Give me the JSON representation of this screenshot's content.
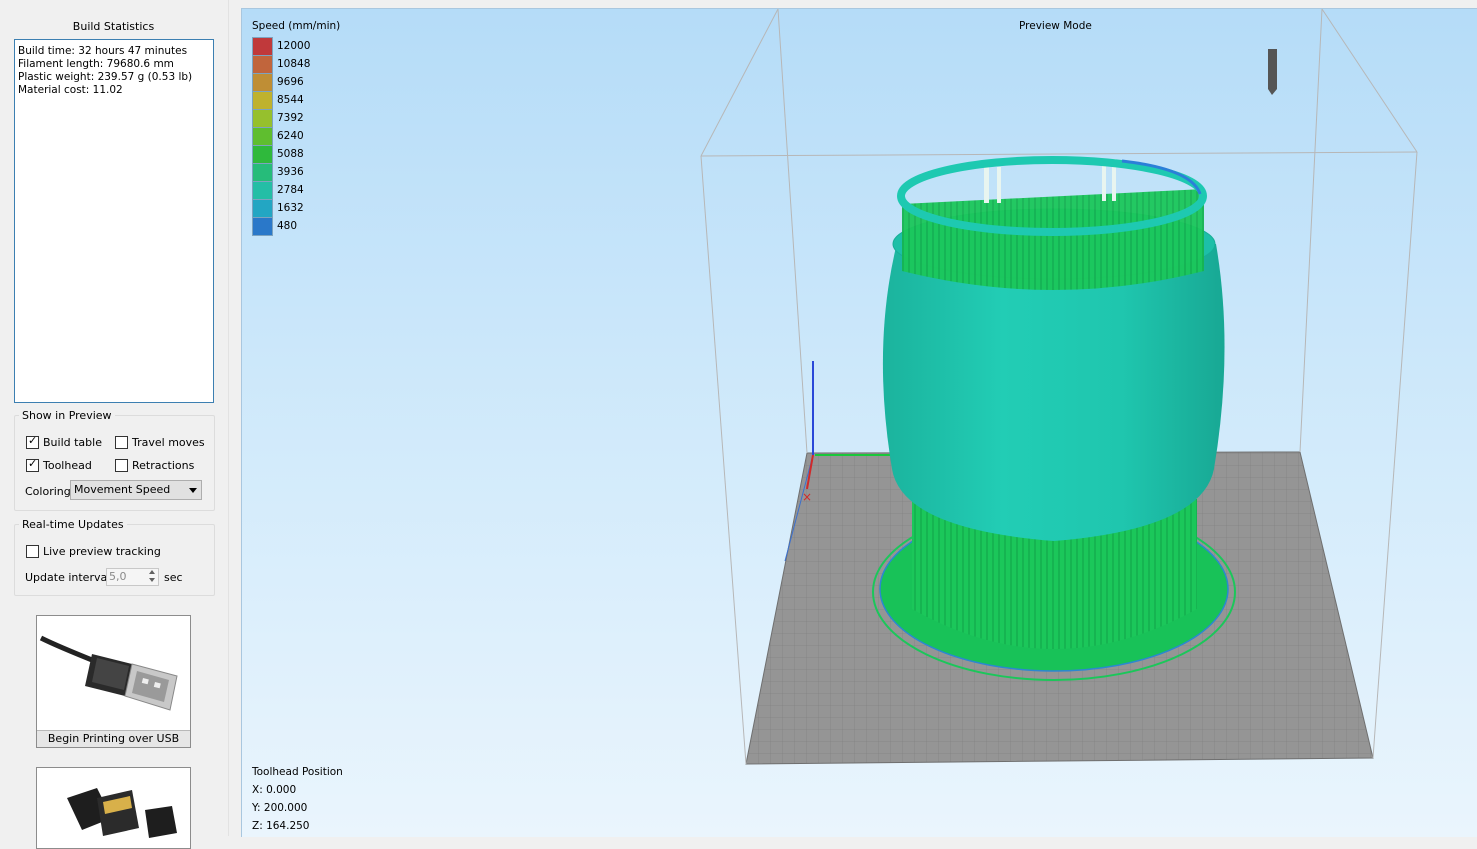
{
  "build_statistics": {
    "title": "Build Statistics",
    "lines": [
      "Build time: 32 hours 47 minutes",
      "Filament length: 79680.6 mm",
      "Plastic weight: 239.57 g (0.53 lb)",
      "Material cost: 11.02"
    ]
  },
  "show_in_preview": {
    "title": "Show in Preview",
    "build_table": {
      "label": "Build table",
      "checked": true
    },
    "travel_moves": {
      "label": "Travel moves",
      "checked": false
    },
    "toolhead": {
      "label": "Toolhead",
      "checked": true
    },
    "retractions": {
      "label": "Retractions",
      "checked": false
    },
    "coloring_label": "Coloring",
    "coloring_value": "Movement Speed"
  },
  "realtime_updates": {
    "title": "Real-time Updates",
    "live_preview": {
      "label": "Live preview tracking",
      "checked": false
    },
    "interval_label": "Update interval",
    "interval_value": "5,0",
    "interval_unit": "sec"
  },
  "usb_tile": {
    "label": "Begin Printing over USB"
  },
  "viewport": {
    "mode_label": "Preview Mode",
    "legend_title": "Speed (mm/min)",
    "legend": [
      {
        "label": "12000",
        "color": "#c0393b"
      },
      {
        "label": "10848",
        "color": "#c1653c"
      },
      {
        "label": "9696",
        "color": "#bf8e35"
      },
      {
        "label": "8544",
        "color": "#bfb22e"
      },
      {
        "label": "7392",
        "color": "#96c02d"
      },
      {
        "label": "6240",
        "color": "#5fbe2f"
      },
      {
        "label": "5088",
        "color": "#2fb93c"
      },
      {
        "label": "3936",
        "color": "#26bc7a"
      },
      {
        "label": "2784",
        "color": "#24bea6"
      },
      {
        "label": "1632",
        "color": "#23a6c3"
      },
      {
        "label": "480",
        "color": "#2a78c9"
      }
    ],
    "toolhead_position": {
      "title": "Toolhead Position",
      "x": "X: 0.000",
      "y": "Y: 200.000",
      "z": "Z: 164.250"
    }
  },
  "colors": {
    "viewport_top": "#b5dcf8",
    "print_body": "#1ec8b0",
    "support": "#18c85a",
    "build_plate": "#959595"
  }
}
